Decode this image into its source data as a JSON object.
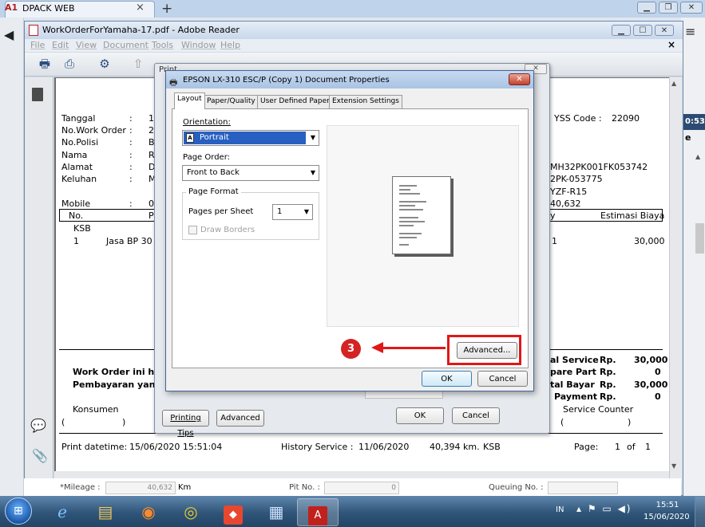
{
  "browser": {
    "tab_logo": "A1",
    "tab_title": "DPACK WEB",
    "tab_close": "×",
    "new_tab": "+",
    "right_time_fragment": "0:53",
    "right_e": "e"
  },
  "reader": {
    "title": "WorkOrderForYamaha-17.pdf - Adobe Reader",
    "menu": [
      "File",
      "Edit",
      "View",
      "Document",
      "Tools",
      "Window",
      "Help"
    ],
    "menubar_close": "×"
  },
  "doc": {
    "labels": {
      "tanggal": "Tanggal",
      "work_order": "No.Work Order",
      "polisi": "No.Polisi",
      "nama": "Nama",
      "alamat": "Alamat",
      "keluhan": "Keluhan",
      "mobile": "Mobile",
      "colon": ":"
    },
    "value_frags": {
      "tanggal": "15",
      "work_order": "20",
      "polisi": "B",
      "nama": "R",
      "alamat": "D",
      "keluhan": "M",
      "mobile": "08"
    },
    "yss_label": "YSS Code :",
    "yss_code": "22090",
    "frame_no": "MH32PK001FK053742",
    "engine_no": "2PK-053775",
    "model": "YZF-R15",
    "km_frag": "40,632",
    "table_header": {
      "no": "No.",
      "p_frag": "P",
      "y_frag": "y",
      "estimasi": "Estimasi Biaya"
    },
    "group": "KSB",
    "row": {
      "no": "1",
      "desc": "Jasa BP 30",
      "qty": "1",
      "amount": "30,000"
    },
    "totals": [
      {
        "label": "al Service",
        "rp": "Rp.",
        "value": "30,000"
      },
      {
        "label": "pare Part",
        "rp": "Rp.",
        "value": "0"
      },
      {
        "label": "tal Bayar",
        "rp": "Rp.",
        "value": "30,000"
      },
      {
        "label": "Payment",
        "rp": "Rp.",
        "value": "0"
      }
    ],
    "service_counter": "Service Counter",
    "bracket_open": "(",
    "bracket_close": ")",
    "note1": "Work Order ini han",
    "note2": "Pembayaran yang s",
    "konsumen": "Konsumen",
    "print_datetime_label": "Print datetime:",
    "print_datetime": "15/06/2020 15:51:04",
    "history_label": "History Service :",
    "history_date": "11/06/2020",
    "history_km": "40,394 km.",
    "history_type": "KSB",
    "page_label": "Page:",
    "page_no": "1",
    "page_of": "of",
    "page_total": "1"
  },
  "webapp": {
    "mileage_label": "*Mileage :",
    "mileage_value": "40,632",
    "mileage_unit": "Km",
    "pit_label": "Pit No. :",
    "pit_value": "0",
    "queue_label": "Queuing No. :"
  },
  "print_dialog": {
    "title": "Print",
    "close": "✕",
    "printing_tips": "Printing Tips",
    "advanced": "Advanced",
    "ok": "OK",
    "cancel": "Cancel"
  },
  "props": {
    "title": "EPSON LX-310 ESC/P (Copy 1) Document Properties",
    "close": "✕",
    "tabs": [
      "Layout",
      "Paper/Quality",
      "User Defined Paper",
      "Extension Settings"
    ],
    "orientation_label": "Orientation:",
    "orientation_value": "Portrait",
    "page_order_label": "Page Order:",
    "page_order_value": "Front to Back",
    "page_format_label": "Page Format",
    "pages_per_sheet_label": "Pages per Sheet",
    "pages_per_sheet_value": "1",
    "draw_borders_label": "Draw Borders",
    "advanced_button": "Advanced...",
    "ok": "OK",
    "cancel": "Cancel"
  },
  "annotation": {
    "step": "3"
  },
  "taskbar": {
    "lang": "IN",
    "time": "15:51",
    "date": "15/06/2020"
  },
  "colors": {
    "annotation_red": "#e01818",
    "selection_blue": "#2860c2",
    "titlebar_blue": "#a9c3e3"
  }
}
